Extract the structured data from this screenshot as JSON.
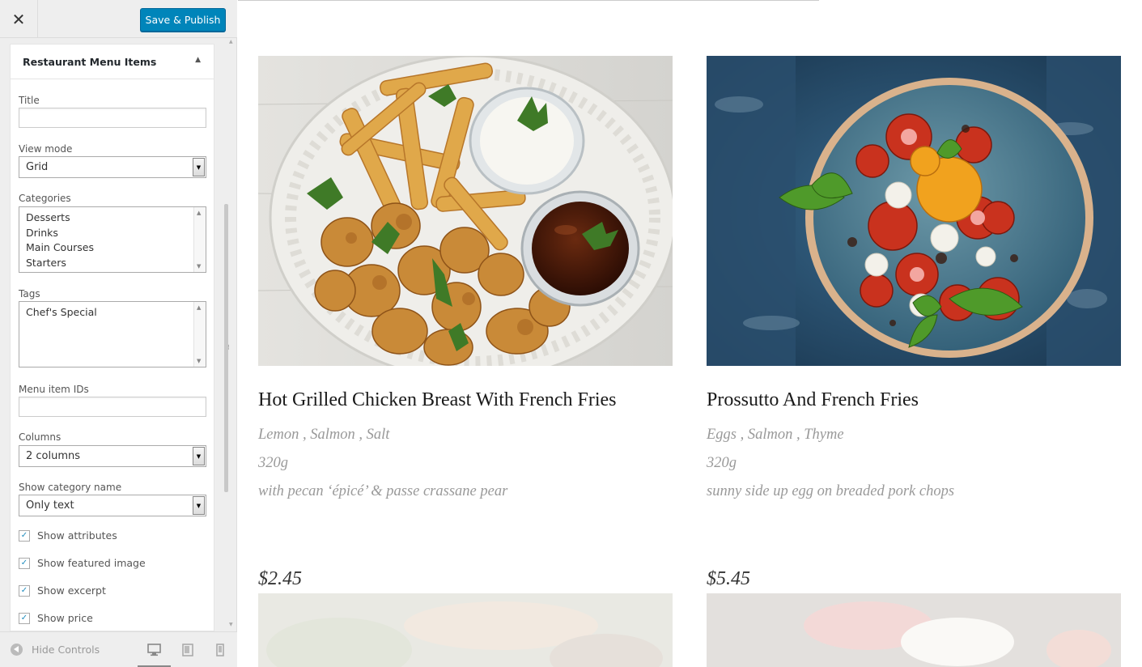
{
  "topbar": {
    "close_glyph": "✕",
    "publish_label": "Save & Publish"
  },
  "panel": {
    "title": "Restaurant Menu Items",
    "fields": {
      "title_label": "Title",
      "title_value": "",
      "view_mode_label": "View mode",
      "view_mode_value": "Grid",
      "categories_label": "Categories",
      "categories": [
        "Desserts",
        "Drinks",
        "Main Courses",
        "Starters"
      ],
      "tags_label": "Tags",
      "tags": [
        "Chef's Special"
      ],
      "ids_label": "Menu item IDs",
      "ids_value": "",
      "columns_label": "Columns",
      "columns_value": "2 columns",
      "showcat_label": "Show category name",
      "showcat_value": "Only text"
    },
    "checks": [
      {
        "label": "Show attributes",
        "checked": true
      },
      {
        "label": "Show featured image",
        "checked": true
      },
      {
        "label": "Show excerpt",
        "checked": true
      },
      {
        "label": "Show price",
        "checked": true
      }
    ]
  },
  "footer": {
    "hide_label": "Hide Controls",
    "devices": [
      "desktop-icon",
      "tablet-icon",
      "mobile-icon"
    ],
    "active_device": "desktop"
  },
  "items": [
    {
      "name": "Hot Grilled Chicken Breast With French Fries",
      "ingredients": "Lemon , Salmon , Salt",
      "weight": "320g",
      "excerpt": "with pecan ‘épicé’ & passe crassane pear",
      "price": "$2.45",
      "image": "fried-chicken-fries-photo"
    },
    {
      "name": "Prossutto And French Fries",
      "ingredients": "Eggs , Salmon , Thyme",
      "weight": "320g",
      "excerpt": "sunny side up egg on breaded pork chops",
      "price": "$5.45",
      "image": "tomato-mozzarella-bowl-photo"
    }
  ],
  "colors": {
    "accent": "#0085ba",
    "sidebar_bg": "#eeeeee",
    "meta_text": "#999999"
  }
}
